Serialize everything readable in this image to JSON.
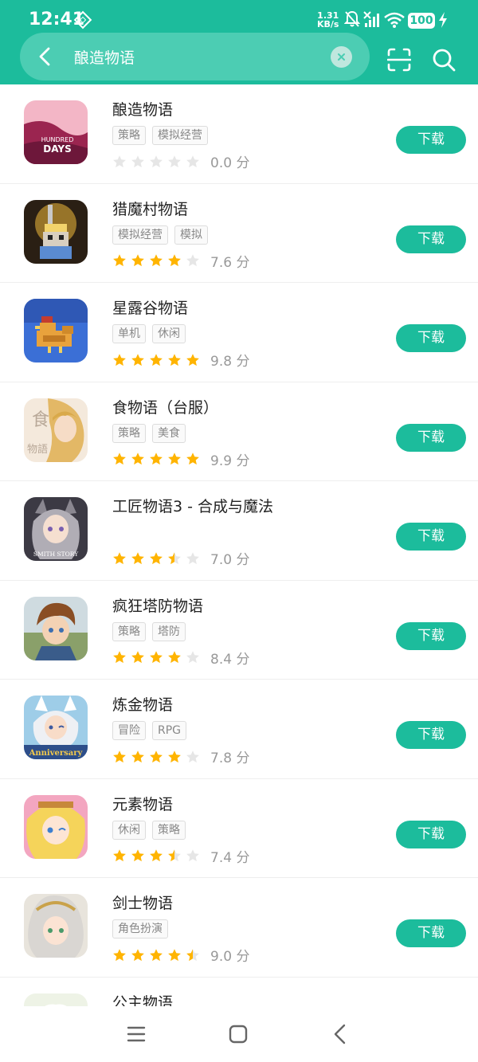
{
  "status_bar": {
    "time": "12:41",
    "net_speed_value": "1.31",
    "net_speed_unit": "KB/s",
    "battery": "100"
  },
  "search": {
    "query": "酿造物语"
  },
  "colors": {
    "accent": "#1cbc9c",
    "star_filled": "#ffb400",
    "star_empty": "#e6e6e6"
  },
  "apps": [
    {
      "name": "酿造物语",
      "tags": [
        "策略",
        "模拟经营"
      ],
      "stars": 0,
      "score": "0.0 分",
      "download_label": "下载",
      "icon": "hundred-days-icon",
      "icon_text": [
        "HUNDRED",
        "DAYS"
      ]
    },
    {
      "name": "猎魔村物语",
      "tags": [
        "模拟经营",
        "模拟"
      ],
      "stars": 4,
      "score": "7.6 分",
      "download_label": "下载",
      "icon": "pixel-hero-icon"
    },
    {
      "name": "星露谷物语",
      "tags": [
        "单机",
        "休闲"
      ],
      "stars": 5,
      "score": "9.8 分",
      "download_label": "下载",
      "icon": "pixel-chicken-icon"
    },
    {
      "name": "食物语（台服）",
      "tags": [
        "策略",
        "美食"
      ],
      "stars": 5,
      "score": "9.9 分",
      "download_label": "下载",
      "icon": "anime-girl-icon",
      "icon_text": [
        "食",
        "物語"
      ]
    },
    {
      "name": "工匠物语3 - 合成与魔法",
      "tags": [],
      "stars": 3.5,
      "score": "7.0 分",
      "download_label": "下载",
      "icon": "smith-story-icon",
      "icon_text": [
        "SMITH STORY"
      ]
    },
    {
      "name": "疯狂塔防物语",
      "tags": [
        "策略",
        "塔防"
      ],
      "stars": 4,
      "score": "8.4 分",
      "download_label": "下载",
      "icon": "anime-boy-icon"
    },
    {
      "name": "炼金物语",
      "tags": [
        "冒险",
        "RPG"
      ],
      "stars": 4,
      "score": "7.8 分",
      "download_label": "下载",
      "icon": "anniversary-icon",
      "icon_text": [
        "Anniversary"
      ]
    },
    {
      "name": "元素物语",
      "tags": [
        "休闲",
        "策略"
      ],
      "stars": 3.5,
      "score": "7.4 分",
      "download_label": "下载",
      "icon": "blonde-girl-icon"
    },
    {
      "name": "剑士物语",
      "tags": [
        "角色扮演"
      ],
      "stars": 4.5,
      "score": "9.0 分",
      "download_label": "下载",
      "icon": "white-hair-girl-icon"
    }
  ],
  "partial_app": {
    "name": "公主物语",
    "icon": "princess-icon"
  },
  "nav": {
    "menu": "menu-icon",
    "home": "home-icon",
    "back": "back-arrow-icon"
  }
}
